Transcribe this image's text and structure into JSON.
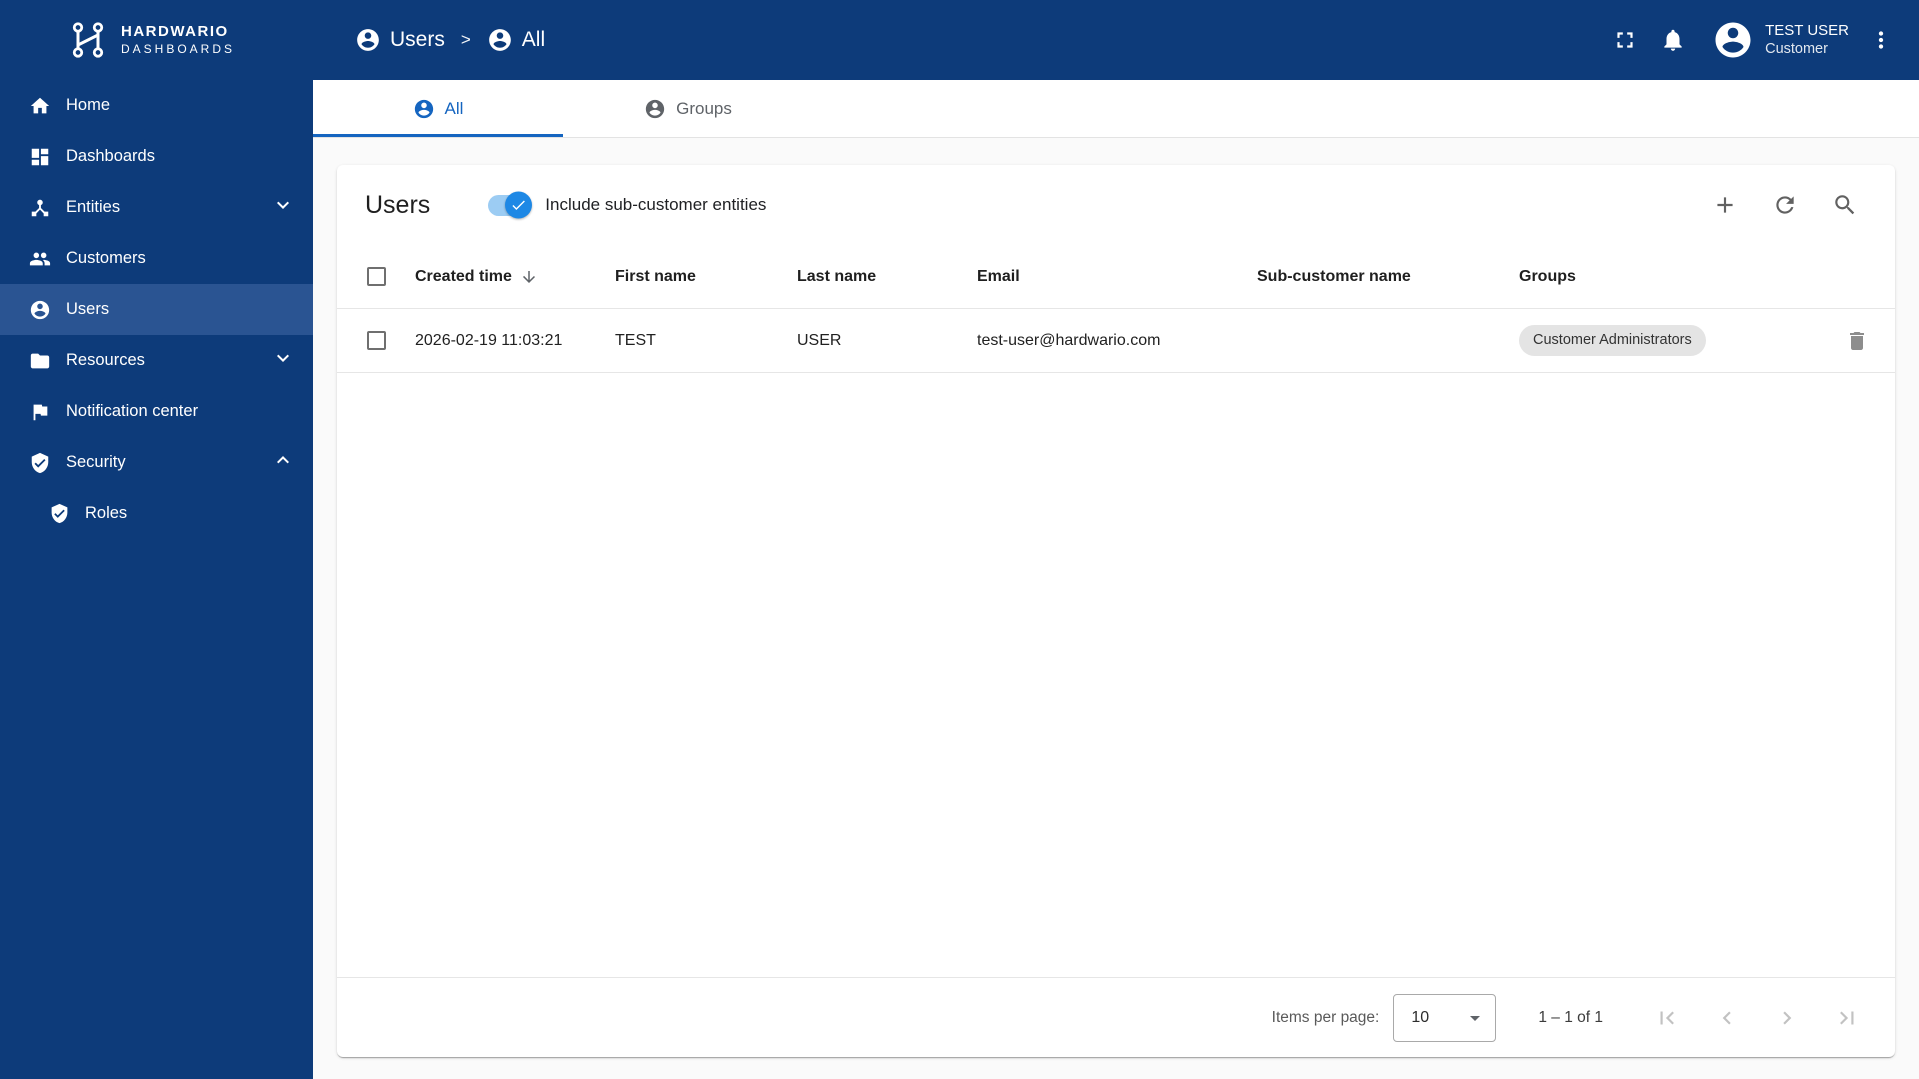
{
  "colors": {
    "brand_navy": "#0d3b7a",
    "sidebar_active": "#2a5492",
    "accent_blue": "#1565c0",
    "toggle_thumb": "#1e88e5",
    "toggle_track": "#9cccf3",
    "chip_bg": "#e4e4e4"
  },
  "header": {
    "logo_line1": "HARDWARIO",
    "logo_line2": "DASHBOARDS",
    "breadcrumb": {
      "level1": "Users",
      "separator": ">",
      "level2": "All"
    },
    "user_name": "TEST USER",
    "user_role": "Customer"
  },
  "sidebar": {
    "items": [
      {
        "label": "Home"
      },
      {
        "label": "Dashboards"
      },
      {
        "label": "Entities"
      },
      {
        "label": "Customers"
      },
      {
        "label": "Users"
      },
      {
        "label": "Resources"
      },
      {
        "label": "Notification center"
      },
      {
        "label": "Security"
      },
      {
        "label": "Roles"
      }
    ]
  },
  "tabs": {
    "all": "All",
    "groups": "Groups"
  },
  "card": {
    "title": "Users",
    "toggle_label": "Include sub-customer entities",
    "columns": {
      "created": "Created time",
      "first": "First name",
      "last": "Last name",
      "email": "Email",
      "sub": "Sub-customer name",
      "groups": "Groups"
    },
    "row": {
      "created": "2026-02-19 11:03:21",
      "first": "TEST",
      "last": "USER",
      "email": "test-user@hardwario.com",
      "sub": "",
      "group_chip": "Customer Administrators"
    },
    "pagination": {
      "label": "Items per page:",
      "size": "10",
      "range": "1 – 1 of 1"
    }
  },
  "icons": {
    "breadcrumb_user": "account-circle",
    "fullscreen": "fullscreen",
    "notifications": "bell",
    "user_menu": "kebab-vertical",
    "add": "plus",
    "refresh": "refresh",
    "search": "magnifier",
    "sort": "arrow-down",
    "delete": "trash",
    "pagination": [
      "first-page",
      "prev-page",
      "next-page",
      "last-page"
    ]
  }
}
